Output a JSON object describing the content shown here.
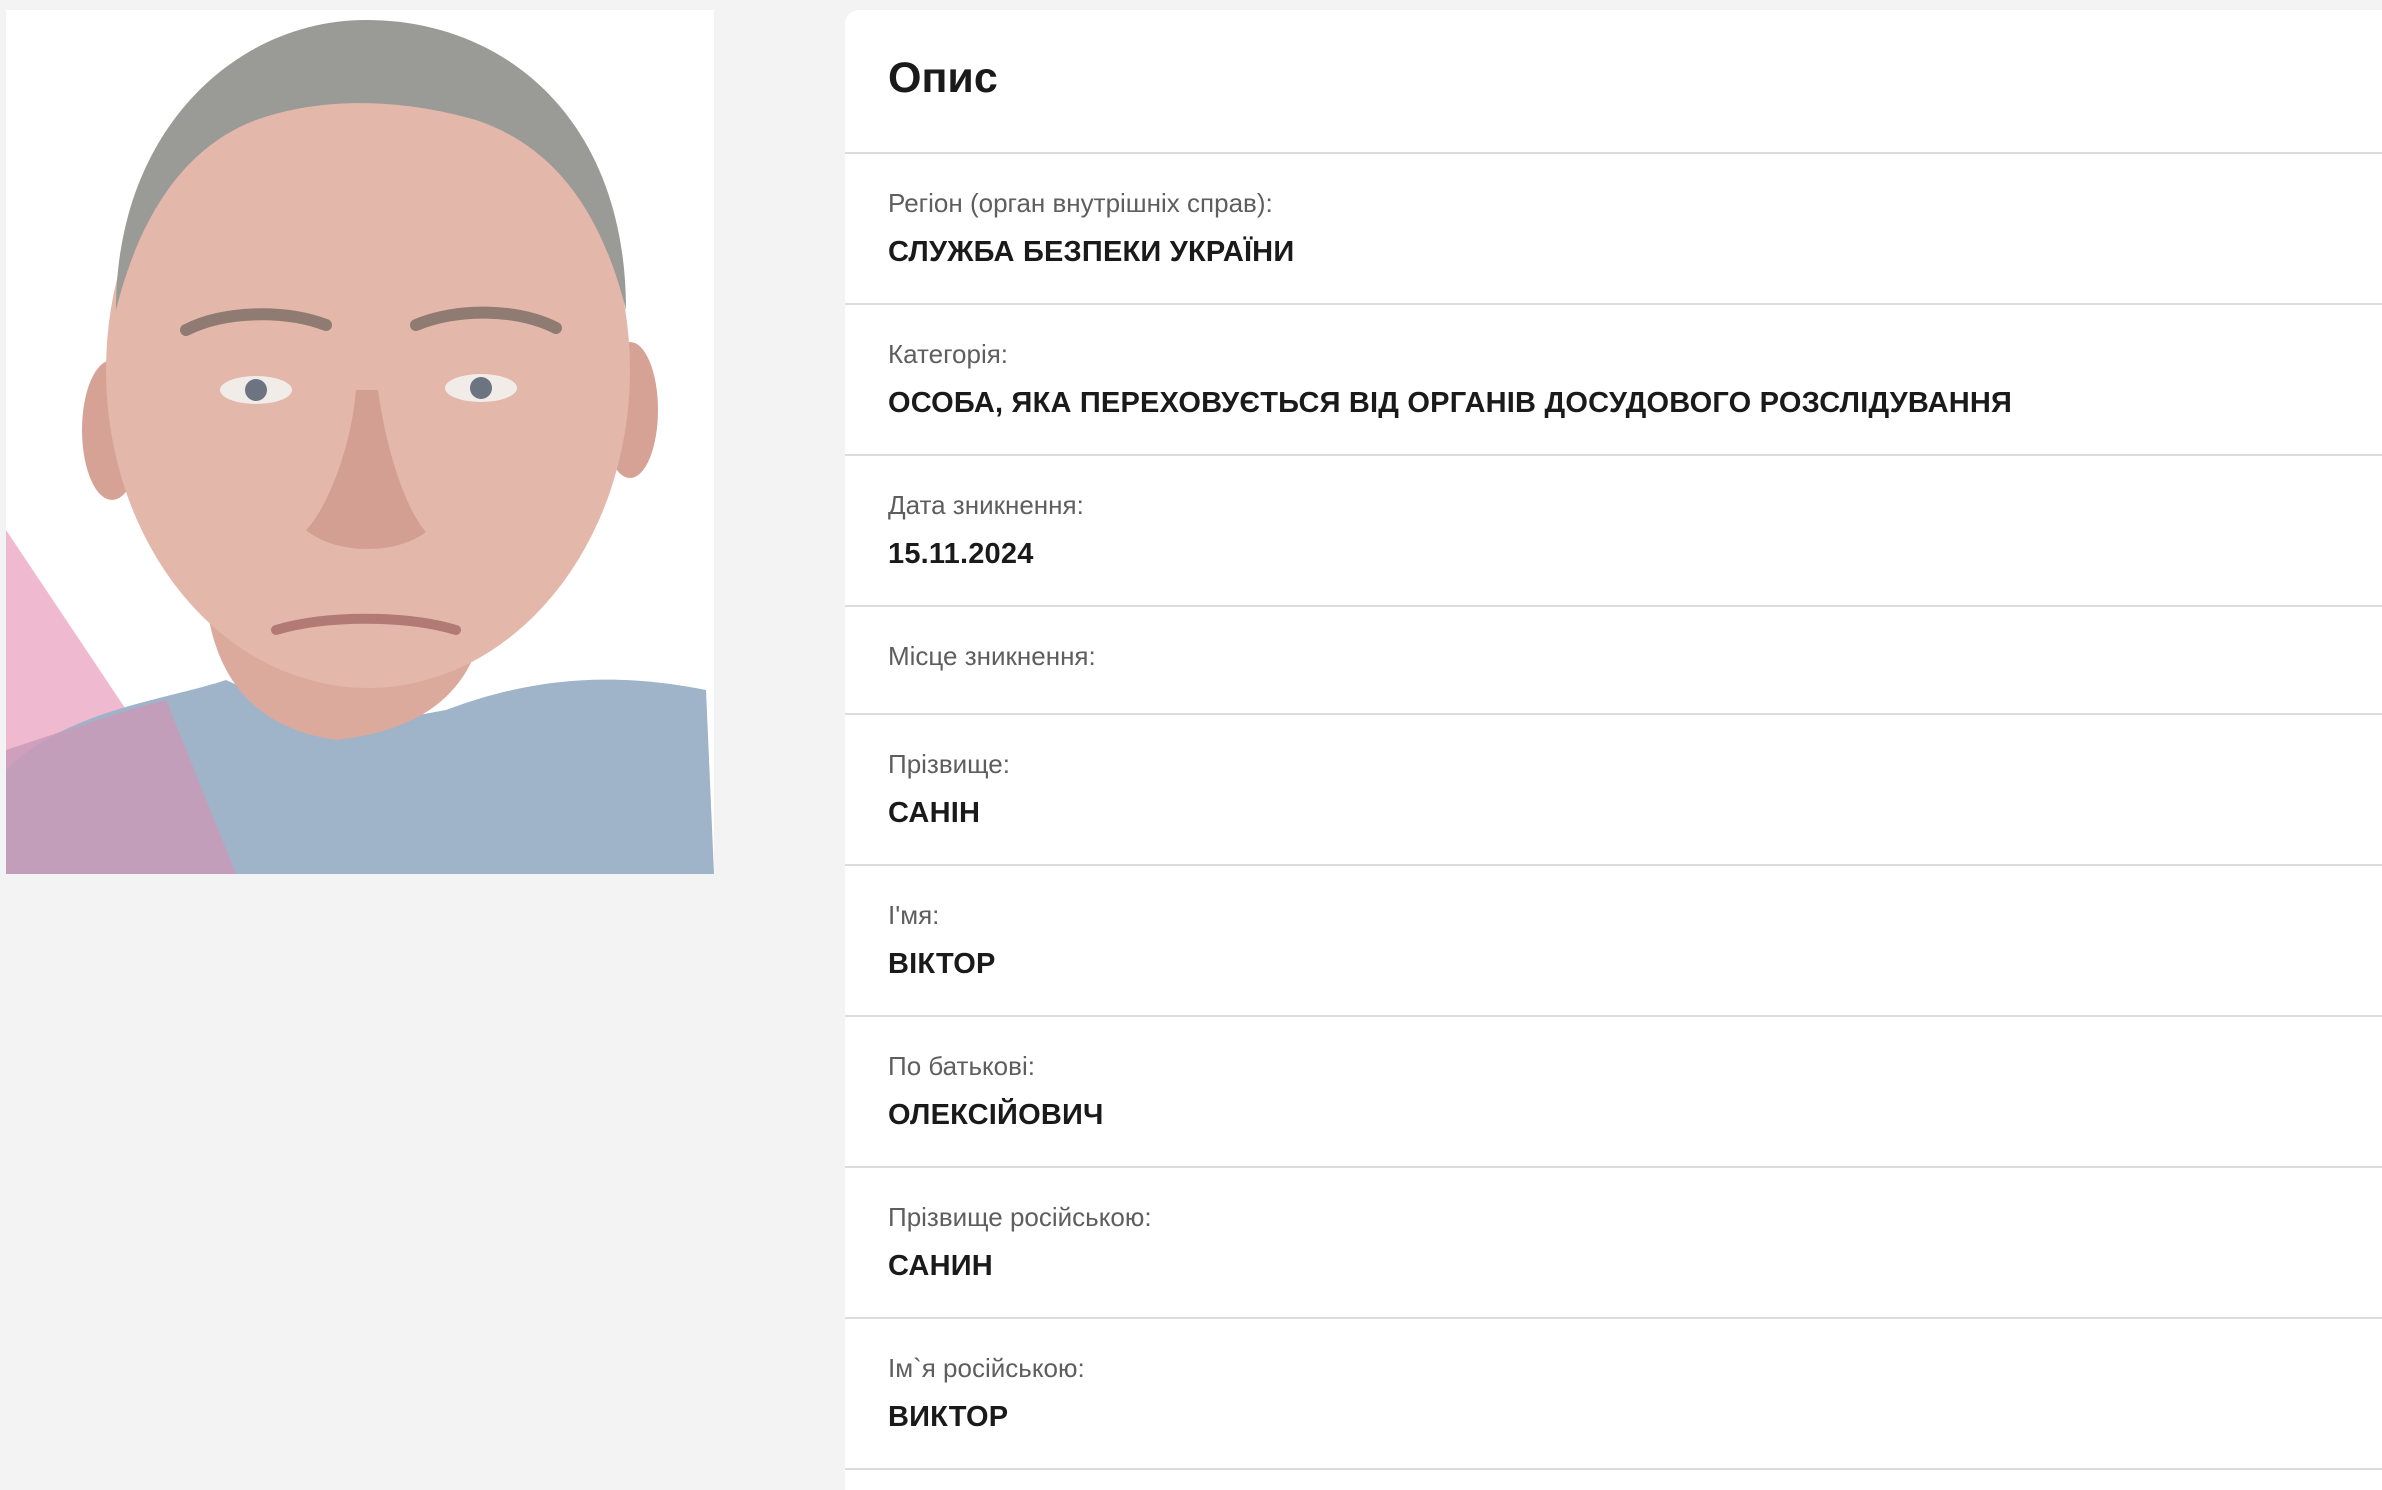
{
  "card": {
    "title": "Опис"
  },
  "fields": [
    {
      "label": "Регіон (орган внутрішніх справ):",
      "value": "СЛУЖБА БЕЗПЕКИ УКРАЇНИ"
    },
    {
      "label": "Категорія:",
      "value": "ОСОБА, ЯКА ПЕРЕХОВУЄТЬСЯ ВІД ОРГАНІВ ДОСУДОВОГО РОЗСЛІДУВАННЯ"
    },
    {
      "label": "Дата зникнення:",
      "value": "15.11.2024"
    },
    {
      "label": "Місце зникнення:",
      "value": ""
    },
    {
      "label": "Прізвище:",
      "value": "САНІН"
    },
    {
      "label": "І'мя:",
      "value": "ВІКТОР"
    },
    {
      "label": "По батькові:",
      "value": "ОЛЕКСІЙОВИЧ"
    },
    {
      "label": "Прізвище російською:",
      "value": "САНИН"
    },
    {
      "label": "Ім`я російською:",
      "value": "ВИКТОР"
    }
  ],
  "colors": {
    "page_background": "#f3f3f3",
    "card_background": "#ffffff",
    "divider": "#dcdcdc",
    "label_text": "#5e5e5e",
    "value_text": "#1a1a1a"
  }
}
